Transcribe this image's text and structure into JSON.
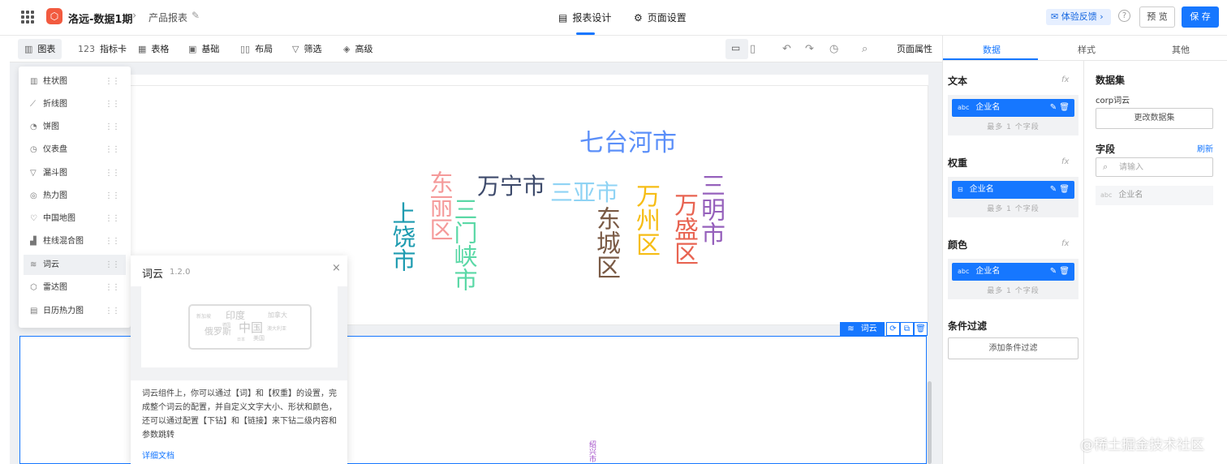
{
  "header": {
    "project_name": "洛远-数据1期",
    "report_name": "产品报表",
    "tabs": [
      {
        "label": "报表设计",
        "icon": "report-design-icon",
        "active": true
      },
      {
        "label": "页面设置",
        "icon": "gear-icon",
        "active": false
      }
    ],
    "feedback_label": "体验反馈",
    "preview_label": "预 览",
    "save_label": "保 存",
    "accent_color": "#1677ff"
  },
  "toolbar": {
    "items": [
      {
        "label": "图表",
        "icon": "bar-chart-icon"
      },
      {
        "label": "指标卡",
        "icon": "metric-card-icon"
      },
      {
        "label": "表格",
        "icon": "table-icon"
      },
      {
        "label": "基础",
        "icon": "basic-icon"
      },
      {
        "label": "布局",
        "icon": "layout-icon"
      },
      {
        "label": "筛选",
        "icon": "filter-icon"
      },
      {
        "label": "高级",
        "icon": "advanced-icon"
      }
    ],
    "page_props_label": "页面属性"
  },
  "chart_menu": {
    "items": [
      {
        "label": "柱状图",
        "icon": "bar-chart-icon"
      },
      {
        "label": "折线图",
        "icon": "line-chart-icon"
      },
      {
        "label": "饼图",
        "icon": "pie-chart-icon"
      },
      {
        "label": "仪表盘",
        "icon": "gauge-icon"
      },
      {
        "label": "漏斗图",
        "icon": "funnel-icon"
      },
      {
        "label": "热力图",
        "icon": "heatmap-icon"
      },
      {
        "label": "中国地图",
        "icon": "china-map-icon"
      },
      {
        "label": "柱线混合图",
        "icon": "bar-line-combo-icon"
      },
      {
        "label": "词云",
        "icon": "word-cloud-icon",
        "active": true
      },
      {
        "label": "雷达图",
        "icon": "radar-icon"
      },
      {
        "label": "日历热力图",
        "icon": "calendar-heatmap-icon"
      }
    ]
  },
  "popover": {
    "title": "词云",
    "version": "1.2.0",
    "preview_words": [
      "新加坡",
      "印度",
      "加拿大",
      "俄罗斯",
      "中国",
      "澳大利亚",
      "美国",
      "德国",
      "日本"
    ],
    "description": "词云组件上，你可以通过【词】和【权重】的设置，完成整个词云的配置，并自定义文字大小、形状和颜色，还可以通过配置【下钻】和【链接】来下钻二级内容和参数跳转",
    "doc_link": "详细文档"
  },
  "word_cloud": {
    "words": [
      {
        "text": "七台河市",
        "color": "#5b8ff9"
      },
      {
        "text": "万宁市",
        "color": "#3d4a6b"
      },
      {
        "text": "三亚市",
        "color": "#8fd3f4"
      },
      {
        "text": "东丽区",
        "color": "#f59a9a"
      },
      {
        "text": "三门峡市",
        "color": "#5ad8a6"
      },
      {
        "text": "上饶市",
        "color": "#1e9bb0"
      },
      {
        "text": "东城区",
        "color": "#7a5a45"
      },
      {
        "text": "万州区",
        "color": "#f6bd16"
      },
      {
        "text": "万盛区",
        "color": "#e86452"
      },
      {
        "text": "三明市",
        "color": "#9661bc"
      }
    ],
    "bottom_word": {
      "text": "绍兴市",
      "color": "#a24cc8"
    }
  },
  "selected_component": {
    "label": "词云"
  },
  "right_panel": {
    "tabs": [
      "数据",
      "样式",
      "其他"
    ],
    "sections": {
      "text": {
        "title": "文本",
        "field": "企业名",
        "type": "abc",
        "hint": "最多 1 个字段"
      },
      "weight": {
        "title": "权重",
        "field": "企业名",
        "type": "num",
        "hint": "最多 1 个字段"
      },
      "color": {
        "title": "颜色",
        "field": "企业名",
        "type": "abc",
        "hint": "最多 1 个字段"
      },
      "filter": {
        "title": "条件过滤",
        "button": "添加条件过滤"
      }
    },
    "fx_label": "fx",
    "dataset": {
      "title": "数据集",
      "name": "corp词云",
      "change_button": "更改数据集",
      "fields_title": "字段",
      "refresh_label": "刷新",
      "search_placeholder": "请输入",
      "fields": [
        {
          "type": "abc",
          "name": "企业名"
        }
      ]
    }
  },
  "watermark": "@稀土掘金技术社区"
}
